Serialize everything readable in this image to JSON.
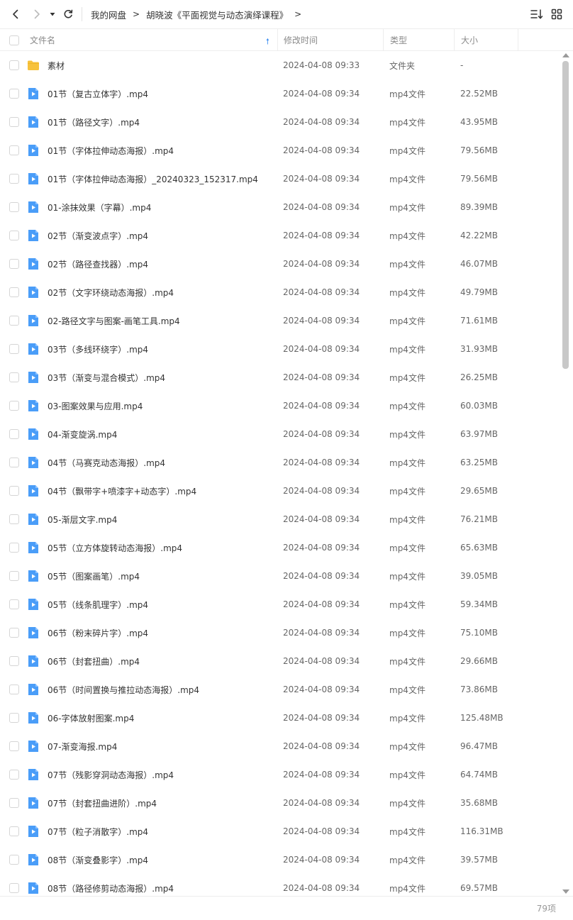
{
  "toolbar": {
    "breadcrumb": [
      "我的网盘",
      "胡晓波《平面视觉与动态演绎课程》"
    ],
    "breadcrumb_separator": ">"
  },
  "columns": {
    "name": "文件名",
    "modified": "修改时间",
    "type": "类型",
    "size": "大小"
  },
  "colors": {
    "accent": "#3a8cf0",
    "folder": "#f7c23c",
    "video_icon": "#4a9df8"
  },
  "files": [
    {
      "name": "素材",
      "modified": "2024-04-08 09:33",
      "type": "文件夹",
      "size": "-",
      "icon": "folder-icon"
    },
    {
      "name": "01节（复古立体字）.mp4",
      "modified": "2024-04-08 09:34",
      "type": "mp4文件",
      "size": "22.52MB",
      "icon": "video-file-icon"
    },
    {
      "name": "01节（路径文字）.mp4",
      "modified": "2024-04-08 09:34",
      "type": "mp4文件",
      "size": "43.95MB",
      "icon": "video-file-icon"
    },
    {
      "name": "01节（字体拉伸动态海报）.mp4",
      "modified": "2024-04-08 09:34",
      "type": "mp4文件",
      "size": "79.56MB",
      "icon": "video-file-icon"
    },
    {
      "name": "01节（字体拉伸动态海报）_20240323_152317.mp4",
      "modified": "2024-04-08 09:34",
      "type": "mp4文件",
      "size": "79.56MB",
      "icon": "video-file-icon"
    },
    {
      "name": "01-涂抹效果（字幕）.mp4",
      "modified": "2024-04-08 09:34",
      "type": "mp4文件",
      "size": "89.39MB",
      "icon": "video-file-icon"
    },
    {
      "name": "02节（渐变波点字）.mp4",
      "modified": "2024-04-08 09:34",
      "type": "mp4文件",
      "size": "42.22MB",
      "icon": "video-file-icon"
    },
    {
      "name": "02节（路径查找器）.mp4",
      "modified": "2024-04-08 09:34",
      "type": "mp4文件",
      "size": "46.07MB",
      "icon": "video-file-icon"
    },
    {
      "name": "02节（文字环绕动态海报）.mp4",
      "modified": "2024-04-08 09:34",
      "type": "mp4文件",
      "size": "49.79MB",
      "icon": "video-file-icon"
    },
    {
      "name": "02-路径文字与图案-画笔工具.mp4",
      "modified": "2024-04-08 09:34",
      "type": "mp4文件",
      "size": "71.61MB",
      "icon": "video-file-icon"
    },
    {
      "name": "03节（多线环绕字）.mp4",
      "modified": "2024-04-08 09:34",
      "type": "mp4文件",
      "size": "31.93MB",
      "icon": "video-file-icon"
    },
    {
      "name": "03节（渐变与混合模式）.mp4",
      "modified": "2024-04-08 09:34",
      "type": "mp4文件",
      "size": "26.25MB",
      "icon": "video-file-icon"
    },
    {
      "name": "03-图案效果与应用.mp4",
      "modified": "2024-04-08 09:34",
      "type": "mp4文件",
      "size": "60.03MB",
      "icon": "video-file-icon"
    },
    {
      "name": "04-渐变旋涡.mp4",
      "modified": "2024-04-08 09:34",
      "type": "mp4文件",
      "size": "63.97MB",
      "icon": "video-file-icon"
    },
    {
      "name": "04节（马赛克动态海报）.mp4",
      "modified": "2024-04-08 09:34",
      "type": "mp4文件",
      "size": "63.25MB",
      "icon": "video-file-icon"
    },
    {
      "name": "04节（飘带字+喷漆字+动态字）.mp4",
      "modified": "2024-04-08 09:34",
      "type": "mp4文件",
      "size": "29.65MB",
      "icon": "video-file-icon"
    },
    {
      "name": "05-渐层文字.mp4",
      "modified": "2024-04-08 09:34",
      "type": "mp4文件",
      "size": "76.21MB",
      "icon": "video-file-icon"
    },
    {
      "name": "05节（立方体旋转动态海报）.mp4",
      "modified": "2024-04-08 09:34",
      "type": "mp4文件",
      "size": "65.63MB",
      "icon": "video-file-icon"
    },
    {
      "name": "05节（图案画笔）.mp4",
      "modified": "2024-04-08 09:34",
      "type": "mp4文件",
      "size": "39.05MB",
      "icon": "video-file-icon"
    },
    {
      "name": "05节（线条肌理字）.mp4",
      "modified": "2024-04-08 09:34",
      "type": "mp4文件",
      "size": "59.34MB",
      "icon": "video-file-icon"
    },
    {
      "name": "06节（粉末碎片字）.mp4",
      "modified": "2024-04-08 09:34",
      "type": "mp4文件",
      "size": "75.10MB",
      "icon": "video-file-icon"
    },
    {
      "name": "06节（封套扭曲）.mp4",
      "modified": "2024-04-08 09:34",
      "type": "mp4文件",
      "size": "29.66MB",
      "icon": "video-file-icon"
    },
    {
      "name": "06节（时间置换与推拉动态海报）.mp4",
      "modified": "2024-04-08 09:34",
      "type": "mp4文件",
      "size": "73.86MB",
      "icon": "video-file-icon"
    },
    {
      "name": "06-字体放射图案.mp4",
      "modified": "2024-04-08 09:34",
      "type": "mp4文件",
      "size": "125.48MB",
      "icon": "video-file-icon"
    },
    {
      "name": "07-渐变海报.mp4",
      "modified": "2024-04-08 09:34",
      "type": "mp4文件",
      "size": "96.47MB",
      "icon": "video-file-icon"
    },
    {
      "name": "07节（残影穿洞动态海报）.mp4",
      "modified": "2024-04-08 09:34",
      "type": "mp4文件",
      "size": "64.74MB",
      "icon": "video-file-icon"
    },
    {
      "name": "07节（封套扭曲进阶）.mp4",
      "modified": "2024-04-08 09:34",
      "type": "mp4文件",
      "size": "35.68MB",
      "icon": "video-file-icon"
    },
    {
      "name": "07节（粒子消散字）.mp4",
      "modified": "2024-04-08 09:34",
      "type": "mp4文件",
      "size": "116.31MB",
      "icon": "video-file-icon"
    },
    {
      "name": "08节（渐变叠影字）.mp4",
      "modified": "2024-04-08 09:34",
      "type": "mp4文件",
      "size": "39.57MB",
      "icon": "video-file-icon"
    },
    {
      "name": "08节（路径修剪动态海报）.mp4",
      "modified": "2024-04-08 09:34",
      "type": "mp4文件",
      "size": "69.57MB",
      "icon": "video-file-icon"
    }
  ],
  "footer": {
    "item_count": "79项"
  }
}
